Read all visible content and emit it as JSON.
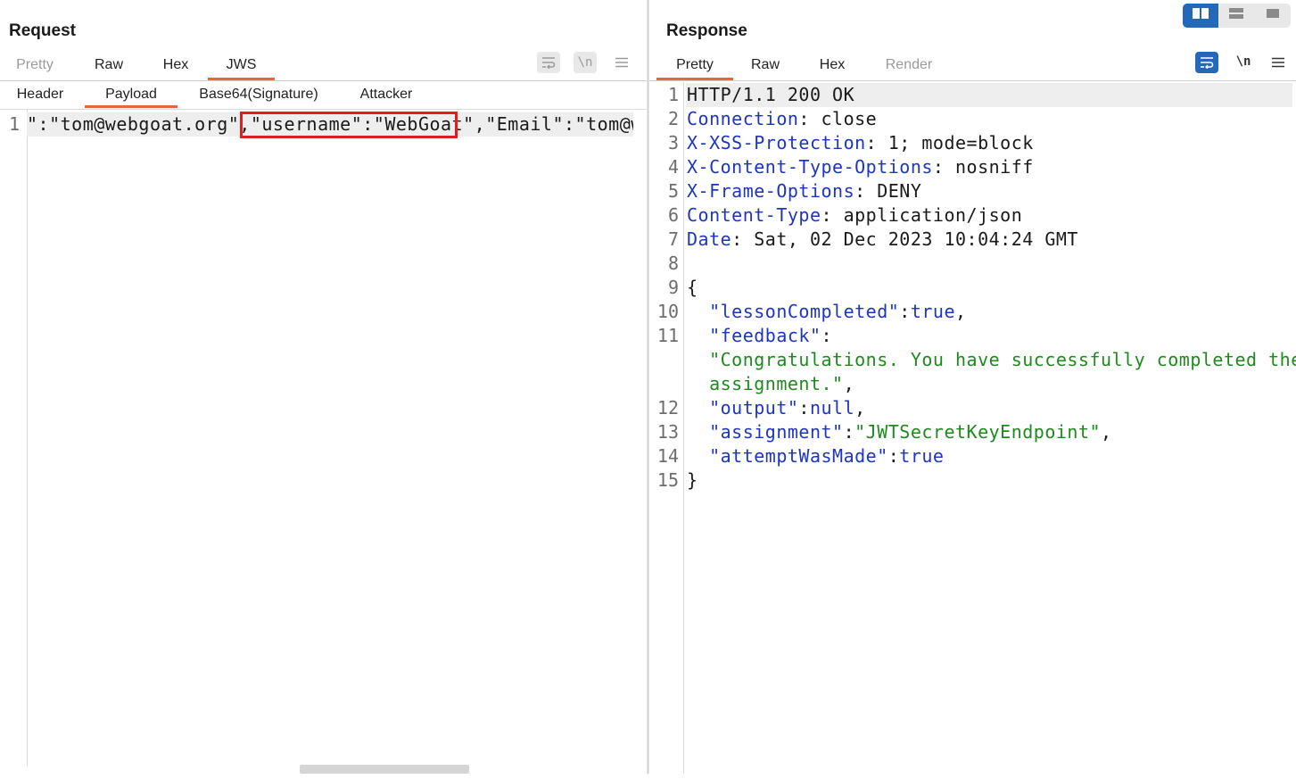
{
  "request": {
    "title": "Request",
    "tabs": [
      {
        "label": "Pretty",
        "state": "disabled"
      },
      {
        "label": "Raw",
        "state": "normal"
      },
      {
        "label": "Hex",
        "state": "normal"
      },
      {
        "label": "JWS",
        "state": "active"
      }
    ],
    "subtabs": [
      {
        "label": "Header",
        "state": "normal"
      },
      {
        "label": "Payload",
        "state": "active"
      },
      {
        "label": "Base64(Signature)",
        "state": "normal"
      },
      {
        "label": "Attacker",
        "state": "normal"
      }
    ],
    "toolbar": {
      "wrap_icon": "word-wrap-icon",
      "newline_label": "\\n",
      "menu_icon": "hamburger-menu-icon"
    },
    "line_number": "1",
    "payload_pre": "\":\"tom@webgoat.org\",",
    "payload_highlight": "\"username\":\"WebGoat\"",
    "payload_post": ",\"Email\":\"tom@web"
  },
  "response": {
    "title": "Response",
    "tabs": [
      {
        "label": "Pretty",
        "state": "active"
      },
      {
        "label": "Raw",
        "state": "normal"
      },
      {
        "label": "Hex",
        "state": "normal"
      },
      {
        "label": "Render",
        "state": "disabled"
      }
    ],
    "toolbar": {
      "wrap_icon": "word-wrap-icon",
      "newline_label": "\\n",
      "menu_icon": "hamburger-menu-icon"
    },
    "lines": [
      {
        "n": "1",
        "parts": [
          {
            "t": "HTTP/1.1 200 OK",
            "c": "p"
          }
        ]
      },
      {
        "n": "2",
        "parts": [
          {
            "t": "Connection",
            "c": "k"
          },
          {
            "t": ": close",
            "c": "p"
          }
        ]
      },
      {
        "n": "3",
        "parts": [
          {
            "t": "X-XSS-Protection",
            "c": "k"
          },
          {
            "t": ": 1; mode=block",
            "c": "p"
          }
        ]
      },
      {
        "n": "4",
        "parts": [
          {
            "t": "X-Content-Type-Options",
            "c": "k"
          },
          {
            "t": ": nosniff",
            "c": "p"
          }
        ]
      },
      {
        "n": "5",
        "parts": [
          {
            "t": "X-Frame-Options",
            "c": "k"
          },
          {
            "t": ": DENY",
            "c": "p"
          }
        ]
      },
      {
        "n": "6",
        "parts": [
          {
            "t": "Content-Type",
            "c": "k"
          },
          {
            "t": ": application/json",
            "c": "p"
          }
        ]
      },
      {
        "n": "7",
        "parts": [
          {
            "t": "Date",
            "c": "k"
          },
          {
            "t": ": Sat, 02 Dec 2023 10:04:24 GMT",
            "c": "p"
          }
        ]
      },
      {
        "n": "8",
        "parts": []
      },
      {
        "n": "9",
        "parts": [
          {
            "t": "{",
            "c": "p"
          }
        ]
      },
      {
        "n": "10",
        "parts": [
          {
            "t": "  \"lessonCompleted\"",
            "c": "k"
          },
          {
            "t": ":",
            "c": "p"
          },
          {
            "t": "true",
            "c": "k"
          },
          {
            "t": ",",
            "c": "p"
          }
        ]
      },
      {
        "n": "11",
        "parts": [
          {
            "t": "  \"feedback\"",
            "c": "k"
          },
          {
            "t": ":",
            "c": "p"
          }
        ]
      },
      {
        "n": "",
        "parts": [
          {
            "t": "  \"Congratulations. You have successfully completed the",
            "c": "s"
          }
        ]
      },
      {
        "n": "",
        "parts": [
          {
            "t": "  assignment.\"",
            "c": "s"
          },
          {
            "t": ",",
            "c": "p"
          }
        ]
      },
      {
        "n": "12",
        "parts": [
          {
            "t": "  \"output\"",
            "c": "k"
          },
          {
            "t": ":",
            "c": "p"
          },
          {
            "t": "null",
            "c": "k"
          },
          {
            "t": ",",
            "c": "p"
          }
        ]
      },
      {
        "n": "13",
        "parts": [
          {
            "t": "  \"assignment\"",
            "c": "k"
          },
          {
            "t": ":",
            "c": "p"
          },
          {
            "t": "\"JWTSecretKeyEndpoint\"",
            "c": "s"
          },
          {
            "t": ",",
            "c": "p"
          }
        ]
      },
      {
        "n": "14",
        "parts": [
          {
            "t": "  \"attemptWasMade\"",
            "c": "k"
          },
          {
            "t": ":",
            "c": "p"
          },
          {
            "t": "true",
            "c": "k"
          }
        ]
      },
      {
        "n": "15",
        "parts": [
          {
            "t": "}",
            "c": "p"
          }
        ]
      }
    ]
  },
  "layout_switch": [
    {
      "icon": "side-by-side-layout-icon",
      "active": true
    },
    {
      "icon": "top-bottom-layout-icon",
      "active": false
    },
    {
      "icon": "single-pane-layout-icon",
      "active": false
    }
  ],
  "colors": {
    "accent": "#e8663d",
    "key": "#1d35c2",
    "string": "#1e8a1e",
    "highlight_box": "#e01e1e",
    "toggle_on": "#2468b8"
  }
}
